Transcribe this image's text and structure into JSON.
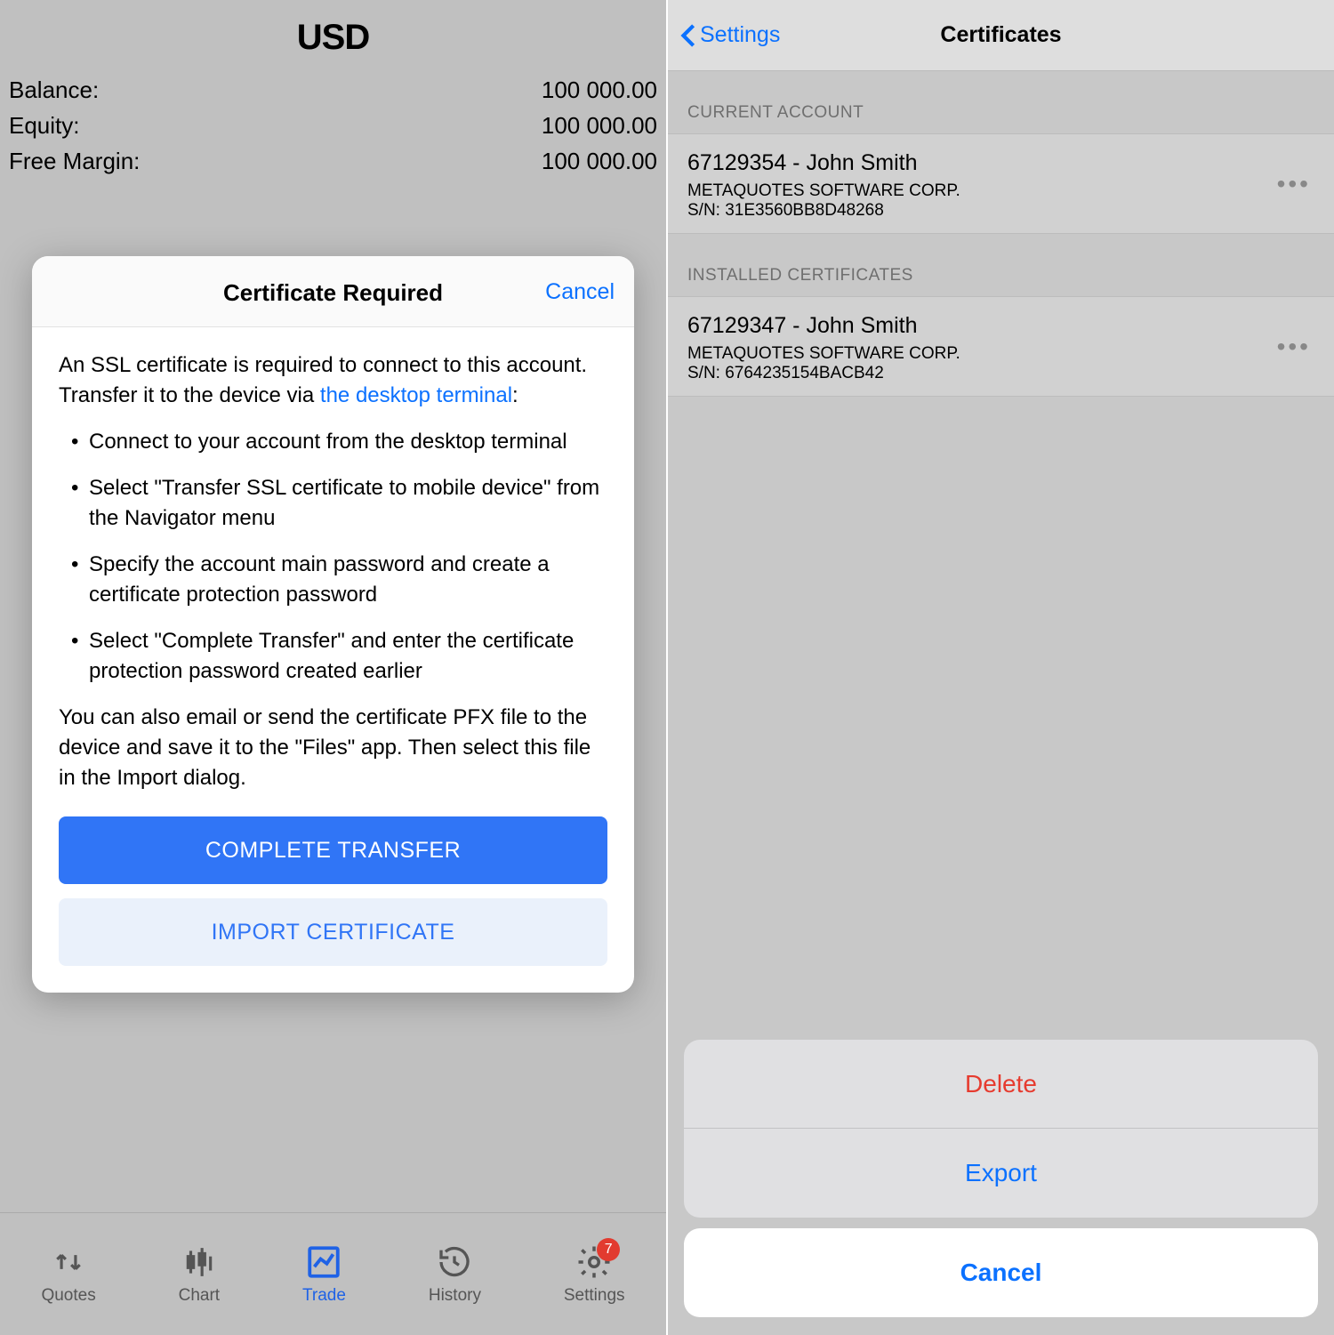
{
  "left": {
    "currency": "USD",
    "rows": {
      "balance_label": "Balance:",
      "balance_value": "100 000.00",
      "equity_label": "Equity:",
      "equity_value": "100 000.00",
      "freemargin_label": "Free Margin:",
      "freemargin_value": "100 000.00"
    },
    "modal": {
      "title": "Certificate Required",
      "cancel": "Cancel",
      "intro_pre": "An SSL certificate is required to connect to this account. Transfer it to the device via ",
      "intro_link": "the desktop terminal",
      "intro_post": ":",
      "steps": [
        "Connect to your account from the desktop terminal",
        "Select \"Transfer SSL certificate to mobile device\" from the Navigator menu",
        "Specify the account main password and create a certificate protection password",
        "Select \"Complete Transfer\" and enter the certificate protection password created earlier"
      ],
      "outro": "You can also email or send the certificate PFX file to the device and save it to the \"Files\" app. Then select this file in the Import dialog.",
      "complete_btn": "COMPLETE TRANSFER",
      "import_btn": "IMPORT CERTIFICATE"
    },
    "tabs": {
      "quotes": "Quotes",
      "chart": "Chart",
      "trade": "Trade",
      "history": "History",
      "settings": "Settings",
      "badge": "7"
    }
  },
  "right": {
    "back_label": "Settings",
    "title": "Certificates",
    "section_current": "CURRENT ACCOUNT",
    "cert_current": {
      "name": "67129354 - John Smith",
      "company": "METAQUOTES SOFTWARE CORP.",
      "sn": "S/N: 31E3560BB8D48268"
    },
    "section_installed": "INSTALLED CERTIFICATES",
    "cert_installed": {
      "name": "67129347 - John Smith",
      "company": "METAQUOTES SOFTWARE CORP.",
      "sn": "S/N: 6764235154BACB42"
    },
    "sheet": {
      "delete": "Delete",
      "export": "Export",
      "cancel": "Cancel"
    }
  }
}
